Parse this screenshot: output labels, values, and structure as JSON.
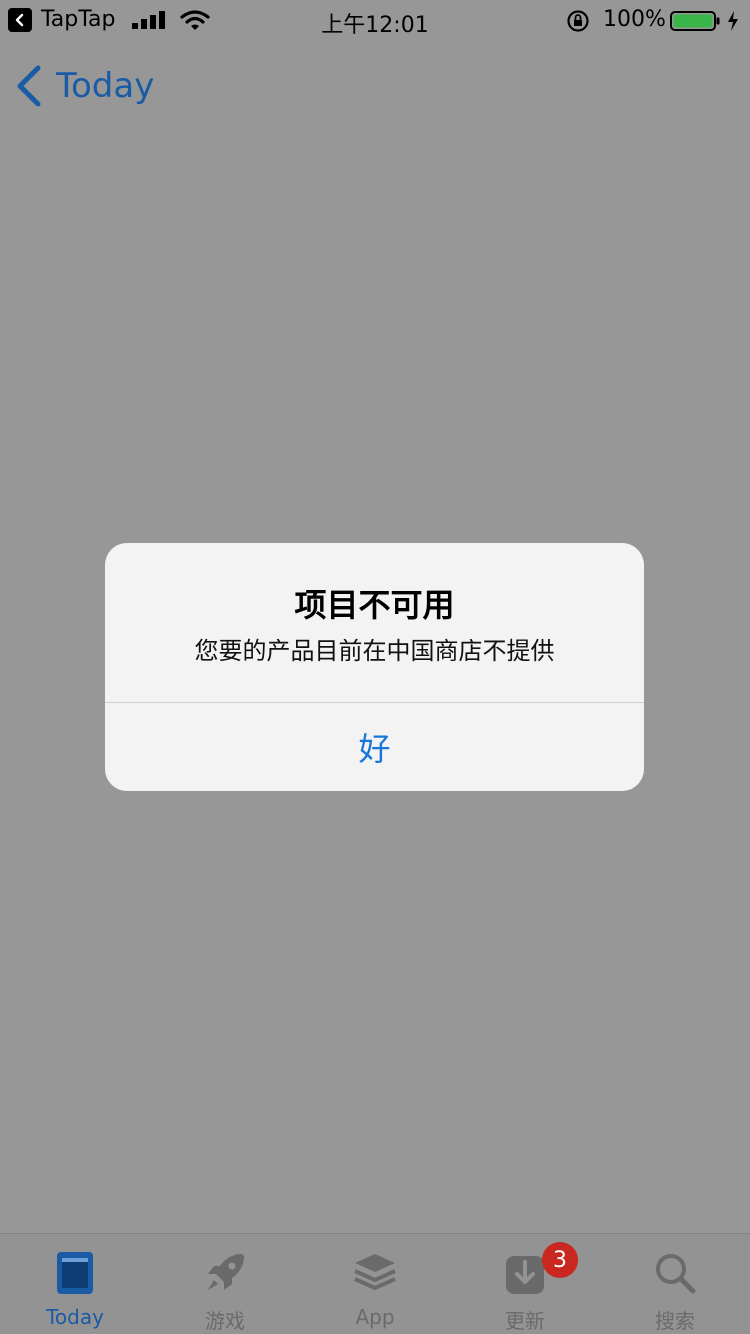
{
  "status_bar": {
    "back_app": "TapTap",
    "time": "上午12:01",
    "battery_percent": "100%"
  },
  "nav": {
    "back_label": "Today"
  },
  "alert": {
    "title": "项目不可用",
    "message": "您要的产品目前在中国商店不提供",
    "button": "好"
  },
  "tabs": [
    {
      "label": "Today",
      "icon": "today-icon",
      "active": true
    },
    {
      "label": "游戏",
      "icon": "rocket-icon"
    },
    {
      "label": "App",
      "icon": "layers-icon"
    },
    {
      "label": "更新",
      "icon": "download-icon",
      "badge": "3"
    },
    {
      "label": "搜索",
      "icon": "search-icon"
    }
  ],
  "colors": {
    "background": "#979797",
    "accent": "#1a5ba5",
    "alert_button": "#1777d8",
    "badge": "#c8281f"
  }
}
